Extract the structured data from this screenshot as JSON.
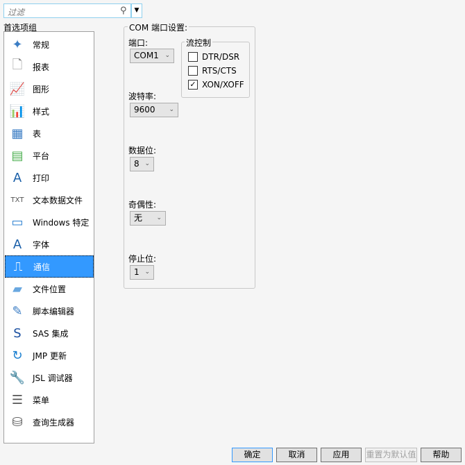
{
  "search": {
    "placeholder": "过滤"
  },
  "groups_label": "首选项组",
  "items": [
    {
      "label": "常规",
      "icon": "✦",
      "color": "#3b7dc4"
    },
    {
      "label": "报表",
      "icon": "🗋",
      "color": "#888"
    },
    {
      "label": "图形",
      "icon": "📈",
      "color": "#1a5fa8"
    },
    {
      "label": "样式",
      "icon": "📊",
      "color": "#1a5fa8"
    },
    {
      "label": "表",
      "icon": "▦",
      "color": "#3b7dc4"
    },
    {
      "label": "平台",
      "icon": "▤",
      "color": "#4caf50"
    },
    {
      "label": "打印",
      "icon": "A",
      "color": "#1a5fa8"
    },
    {
      "label": "文本数据文件",
      "icon": "TXT",
      "color": "#555"
    },
    {
      "label": "Windows 特定",
      "icon": "▭",
      "color": "#2a7fd0"
    },
    {
      "label": "字体",
      "icon": "A",
      "color": "#1a5fa8"
    },
    {
      "label": "通信",
      "icon": "⎍",
      "color": "#ffffff"
    },
    {
      "label": "文件位置",
      "icon": "▰",
      "color": "#6aa8e0"
    },
    {
      "label": "脚本编辑器",
      "icon": "✎",
      "color": "#3b7dc4"
    },
    {
      "label": "SAS 集成",
      "icon": "S",
      "color": "#1a4fa0"
    },
    {
      "label": "JMP 更新",
      "icon": "↻",
      "color": "#1a7fd0"
    },
    {
      "label": "JSL 调试器",
      "icon": "🔧",
      "color": "#666"
    },
    {
      "label": "菜单",
      "icon": "☰",
      "color": "#555"
    },
    {
      "label": "查询生成器",
      "icon": "⛁",
      "color": "#555"
    }
  ],
  "com": {
    "title": "COM 端口设置:",
    "port_label": "端口:",
    "port_value": "COM1",
    "baud_label": "波特率:",
    "baud_value": "9600",
    "data_label": "数据位:",
    "data_value": "8",
    "parity_label": "奇偶性:",
    "parity_value": "无",
    "stop_label": "停止位:",
    "stop_value": "1",
    "flow_title": "流控制",
    "flow": [
      {
        "label": "DTR/DSR",
        "checked": false
      },
      {
        "label": "RTS/CTS",
        "checked": false
      },
      {
        "label": "XON/XOFF",
        "checked": true
      }
    ]
  },
  "buttons": {
    "ok": "确定",
    "cancel": "取消",
    "apply": "应用",
    "reset": "重置为默认值",
    "help": "帮助"
  }
}
